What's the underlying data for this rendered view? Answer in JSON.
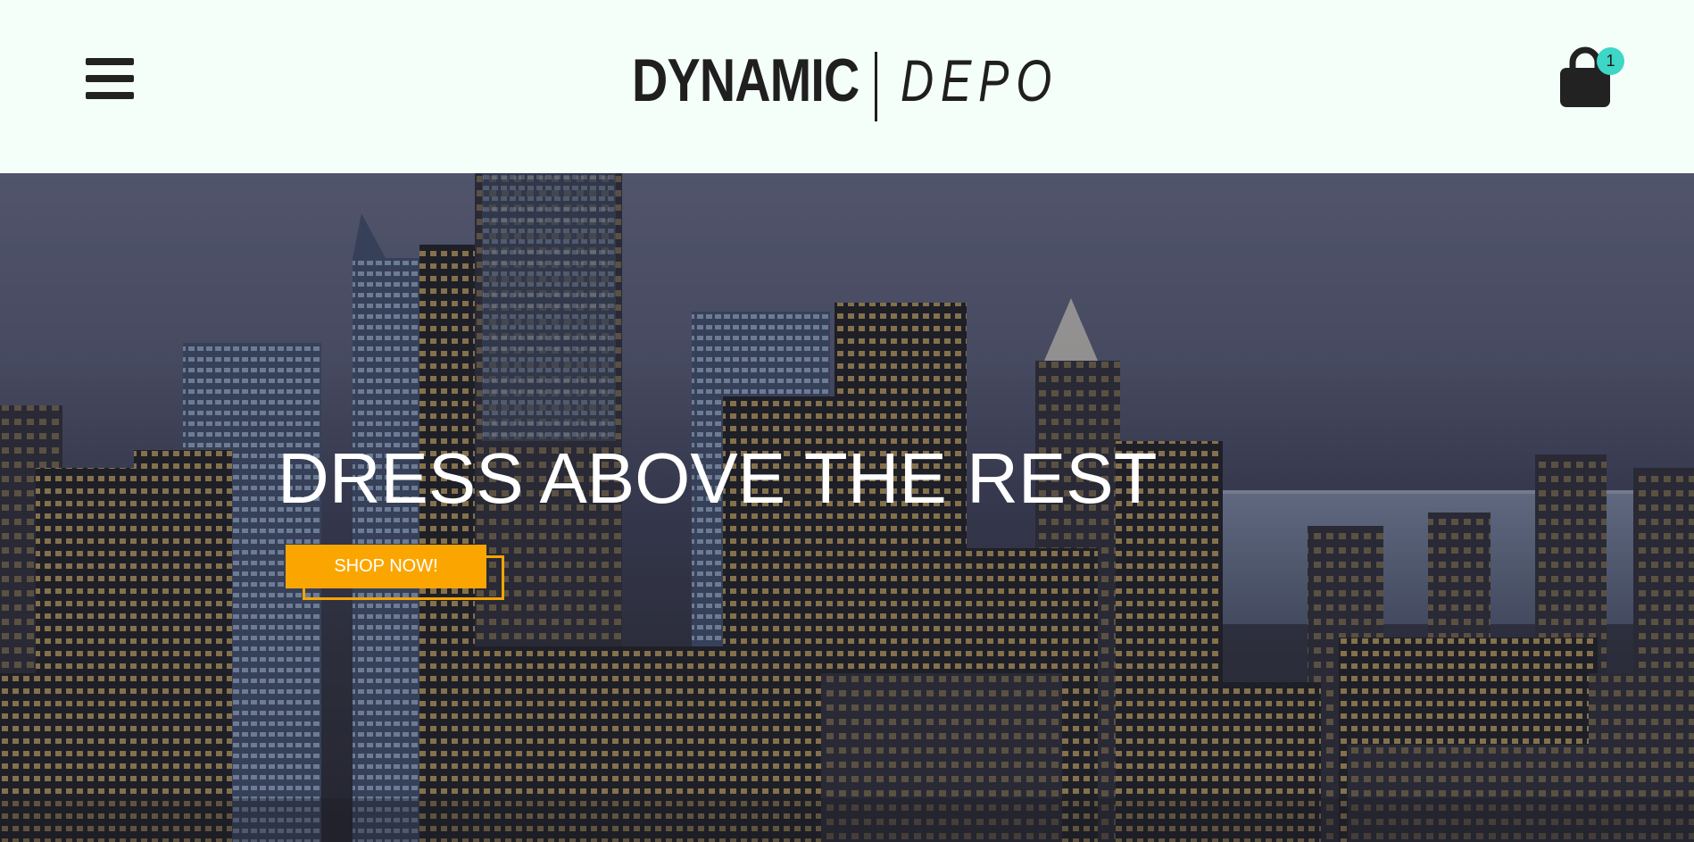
{
  "header": {
    "logo_primary": "DYNAMIC",
    "logo_secondary": "DEPO",
    "cart_count": "1"
  },
  "hero": {
    "headline": "DRESS ABOVE THE REST",
    "cta_label": "SHOP NOW!"
  },
  "colors": {
    "background": "#f5fff9",
    "accent_orange": "#fba600",
    "badge_teal": "#3ed6c6",
    "text_dark": "#1f1f1f"
  },
  "icons": [
    "hamburger-menu-icon",
    "shopping-bag-icon"
  ]
}
